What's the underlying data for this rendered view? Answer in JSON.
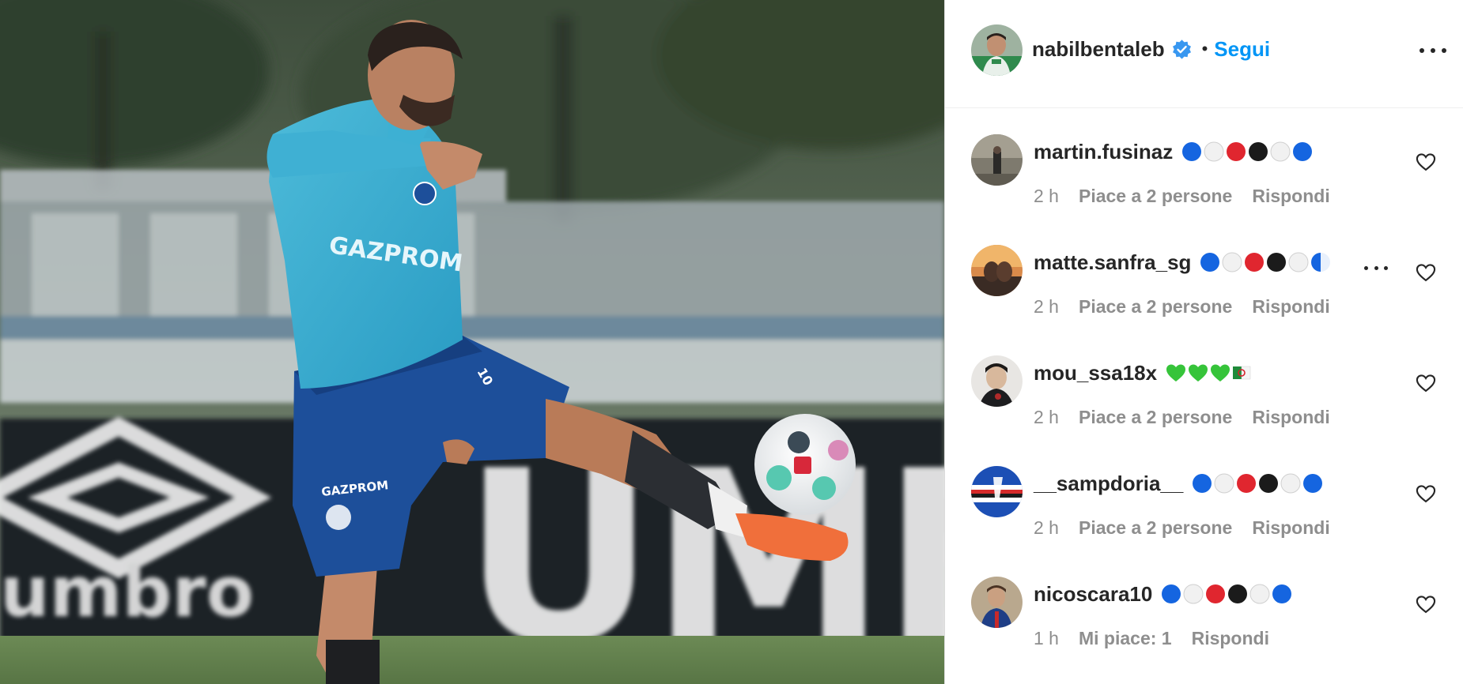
{
  "post": {
    "owner": {
      "username": "nabilbentaleb",
      "verified": true,
      "separator": "•",
      "follow_label": "Segui",
      "avatar_icon": "profile-avatar"
    },
    "more_icon": "more-options-icon",
    "media": {
      "type": "photo",
      "jersey_text": "GAZPROM",
      "shorts_text": "GAZPROM",
      "board_brand": "umbro",
      "board_text": "UMB",
      "number": "10"
    }
  },
  "colors": {
    "follow_blue": "#0095f6",
    "verified_blue": "#3897f0",
    "meta_gray": "#8e8e8e",
    "text_dark": "#262626"
  },
  "comments": [
    {
      "username": "martin.fusinaz",
      "emojis": [
        "blue-circle",
        "white-circle",
        "red-circle",
        "black-circle",
        "white-circle",
        "blue-circle"
      ],
      "time": "2 h",
      "likes": "Piace a 2 persone",
      "reply": "Rispondi",
      "truncated": false
    },
    {
      "username": "matte.sanfra_sg",
      "emojis": [
        "blue-circle",
        "white-circle",
        "red-circle",
        "black-circle",
        "white-circle",
        "half-blue-circle"
      ],
      "time": "2 h",
      "likes": "Piace a 2 persone",
      "reply": "Rispondi",
      "truncated": true
    },
    {
      "username": "mou_ssa18x",
      "emojis": [
        "green-heart",
        "green-heart",
        "green-heart",
        "algeria-flag"
      ],
      "time": "2 h",
      "likes": "Piace a 2 persone",
      "reply": "Rispondi",
      "truncated": false
    },
    {
      "username": "__sampdoria__",
      "emojis": [
        "blue-circle",
        "white-circle",
        "red-circle",
        "black-circle",
        "white-circle",
        "blue-circle"
      ],
      "time": "2 h",
      "likes": "Piace a 2 persone",
      "reply": "Rispondi",
      "truncated": false
    },
    {
      "username": "nicoscara10",
      "emojis": [
        "blue-circle",
        "white-circle",
        "red-circle",
        "black-circle",
        "white-circle",
        "blue-circle"
      ],
      "time": "1 h",
      "likes": "Mi piace: 1",
      "reply": "Rispondi",
      "truncated": false
    }
  ]
}
